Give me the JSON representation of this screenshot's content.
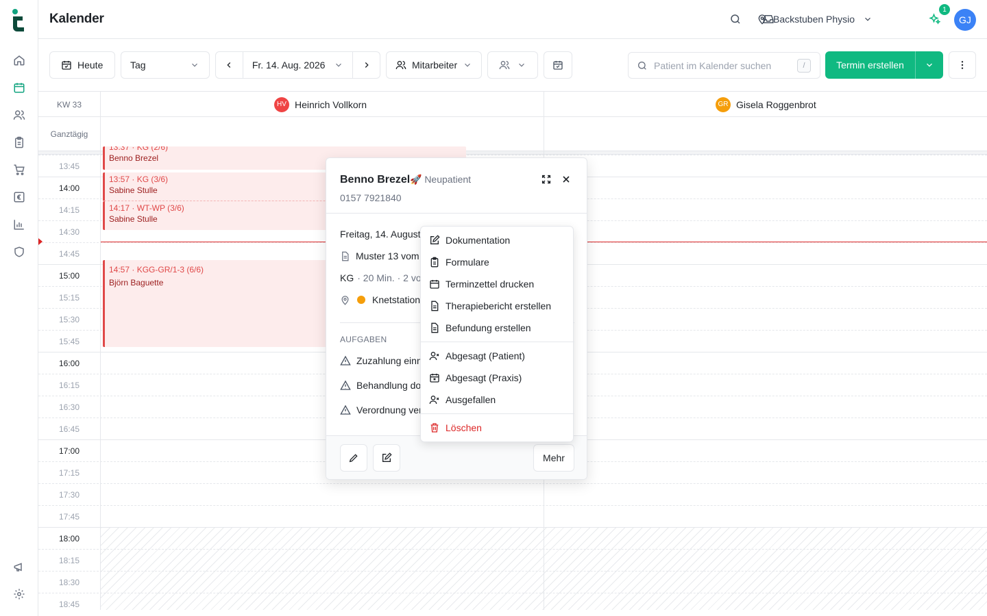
{
  "app": {
    "title": "Kalender"
  },
  "header": {
    "location": "Backstuben Physio",
    "notification_count": "1",
    "user_initials": "GJ"
  },
  "toolbar": {
    "today_label": "Heute",
    "view_value": "Tag",
    "date_value": "Fr. 14. Aug. 2026",
    "staff_label": "Mitarbeiter",
    "search_placeholder": "Patient im Kalender suchen",
    "search_shortcut": "/",
    "create_label": "Termin erstellen"
  },
  "calendar": {
    "week_label": "KW 33",
    "allday_label": "Ganztägig",
    "employees": [
      {
        "initials": "HV",
        "name": "Heinrich Vollkorn",
        "color": "#ef4444"
      },
      {
        "initials": "GR",
        "name": "Gisela Roggenbrot",
        "color": "#f59e0b"
      }
    ],
    "times": [
      "13:45",
      "14:00",
      "14:15",
      "14:30",
      "14:45",
      "15:00",
      "15:15",
      "15:30",
      "15:45",
      "16:00",
      "16:15",
      "16:30",
      "16:45",
      "17:00",
      "17:15",
      "17:30",
      "17:45",
      "18:00",
      "18:15",
      "18:30",
      "18:45"
    ],
    "events": [
      {
        "title": "13:37 · KG (2/6)",
        "patient": "Benno Brezel"
      },
      {
        "title": "13:57 · KG (3/6)",
        "patient": "Sabine Stulle"
      },
      {
        "title": "14:17 · WT-WP (3/6)",
        "patient": "Sabine Stulle"
      },
      {
        "title": "14:57 · KGG-GR/1-3 (6/6)",
        "patient": "Björn Baguette"
      }
    ]
  },
  "popup": {
    "name": "Benno Brezel",
    "tag": "🚀 Neupatient",
    "phone": "0157 7921840",
    "date": "Freitag, 14. August",
    "prescription": "Muster 13 vom",
    "treatment_code": "KG",
    "treatment_detail": "· 20 Min. · 2 von",
    "station": "Knetstation",
    "station_color": "#f59e0b",
    "tasks_heading": "AUFGABEN",
    "tasks": [
      "Zuzahlung einn",
      "Behandlung dol",
      "Verordnung ver"
    ],
    "more_label": "Mehr"
  },
  "menu": {
    "items": [
      "Dokumentation",
      "Formulare",
      "Terminzettel drucken",
      "Therapiebericht erstellen",
      "Befundung erstellen",
      "Abgesagt (Patient)",
      "Abgesagt (Praxis)",
      "Ausgefallen",
      "Löschen"
    ]
  },
  "colors": {
    "accent": "#10b981",
    "danger": "#dc2626",
    "event_bg": "#fdecec",
    "event_border": "#e04848"
  }
}
